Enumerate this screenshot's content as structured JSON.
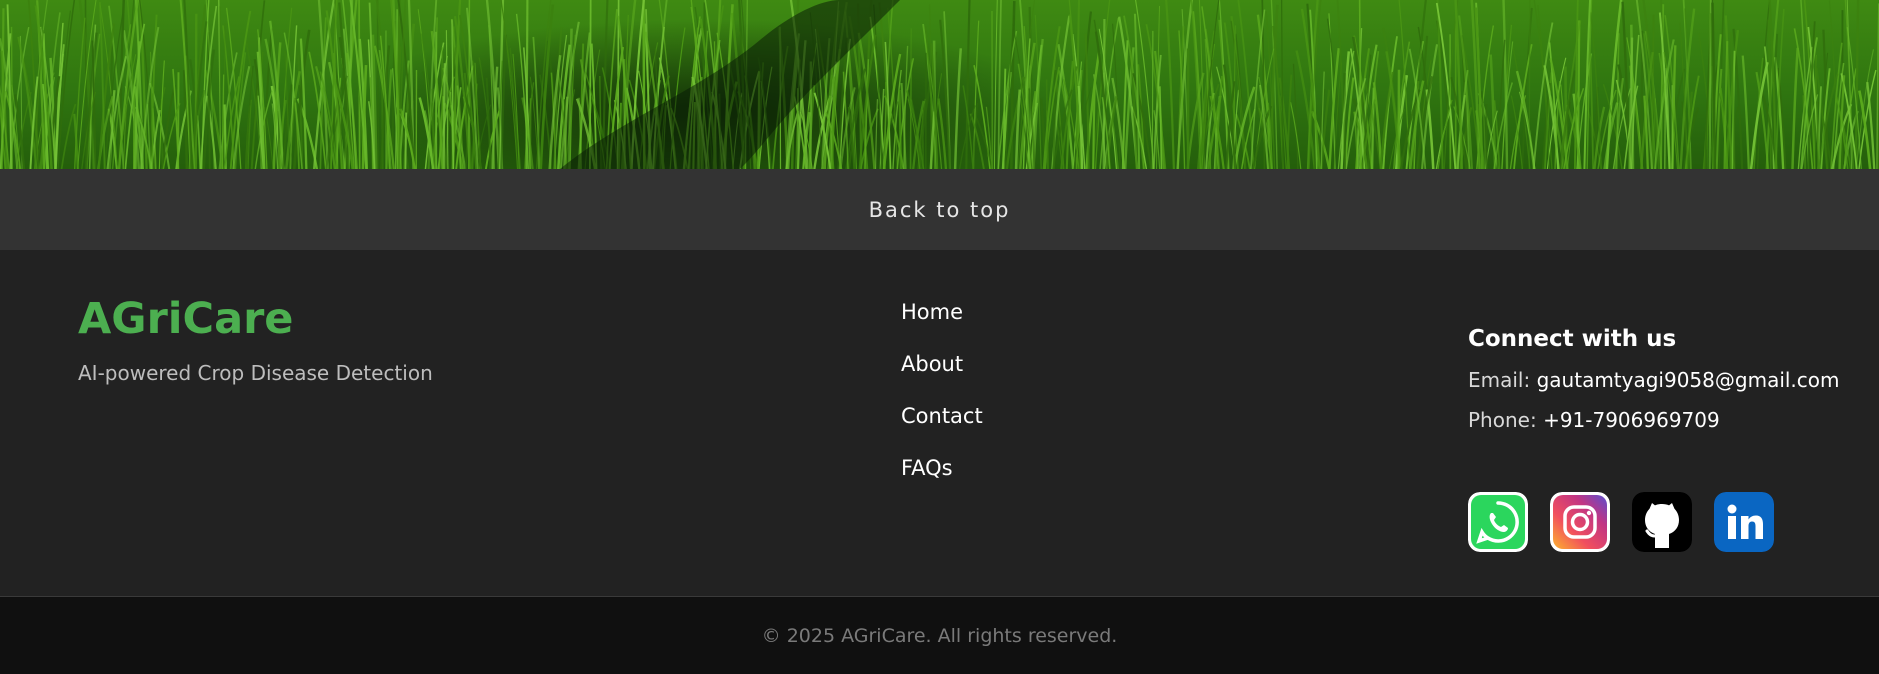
{
  "hero": {
    "image": "green-rice-field"
  },
  "back_to_top": {
    "label": "Back to top"
  },
  "brand": {
    "name": "AGriCare",
    "tagline": "AI-powered Crop Disease Detection",
    "color": "#4caf50"
  },
  "nav_links": [
    {
      "label": "Home"
    },
    {
      "label": "About"
    },
    {
      "label": "Contact"
    },
    {
      "label": "FAQs"
    }
  ],
  "connect": {
    "heading": "Connect with us",
    "email_label": "Email:",
    "email": "gautamtyagi9058@gmail.com",
    "phone_label": "Phone:",
    "phone": "+91-7906969709"
  },
  "social": [
    {
      "name": "whatsapp-icon",
      "color": "#25d366"
    },
    {
      "name": "instagram-icon",
      "color": "#c13584"
    },
    {
      "name": "github-icon",
      "color": "#000000"
    },
    {
      "name": "linkedin-icon",
      "color": "#0a66c2"
    }
  ],
  "copyright": "© 2025 AGriCare. All rights reserved."
}
